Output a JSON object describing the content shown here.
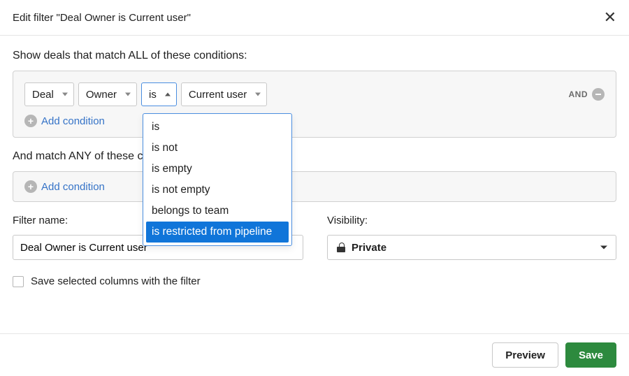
{
  "header": {
    "title": "Edit filter \"Deal Owner is Current user\""
  },
  "sections": {
    "all_label": "Show deals that match ALL of these conditions:",
    "any_label": "And match ANY of these conditions:"
  },
  "condition": {
    "field": "Deal",
    "attribute": "Owner",
    "operator": "is",
    "value": "Current user",
    "and_label": "AND"
  },
  "add_condition_label": "Add condition",
  "dropdown": {
    "options": [
      "is",
      "is not",
      "is empty",
      "is not empty",
      "belongs to team",
      "is restricted from pipeline"
    ],
    "highlighted_index": 5
  },
  "filter_name": {
    "label": "Filter name:",
    "value": "Deal Owner is Current user"
  },
  "visibility": {
    "label": "Visibility:",
    "value": "Private"
  },
  "checkbox": {
    "label": "Save selected columns with the filter",
    "checked": false
  },
  "footer": {
    "preview": "Preview",
    "save": "Save"
  }
}
